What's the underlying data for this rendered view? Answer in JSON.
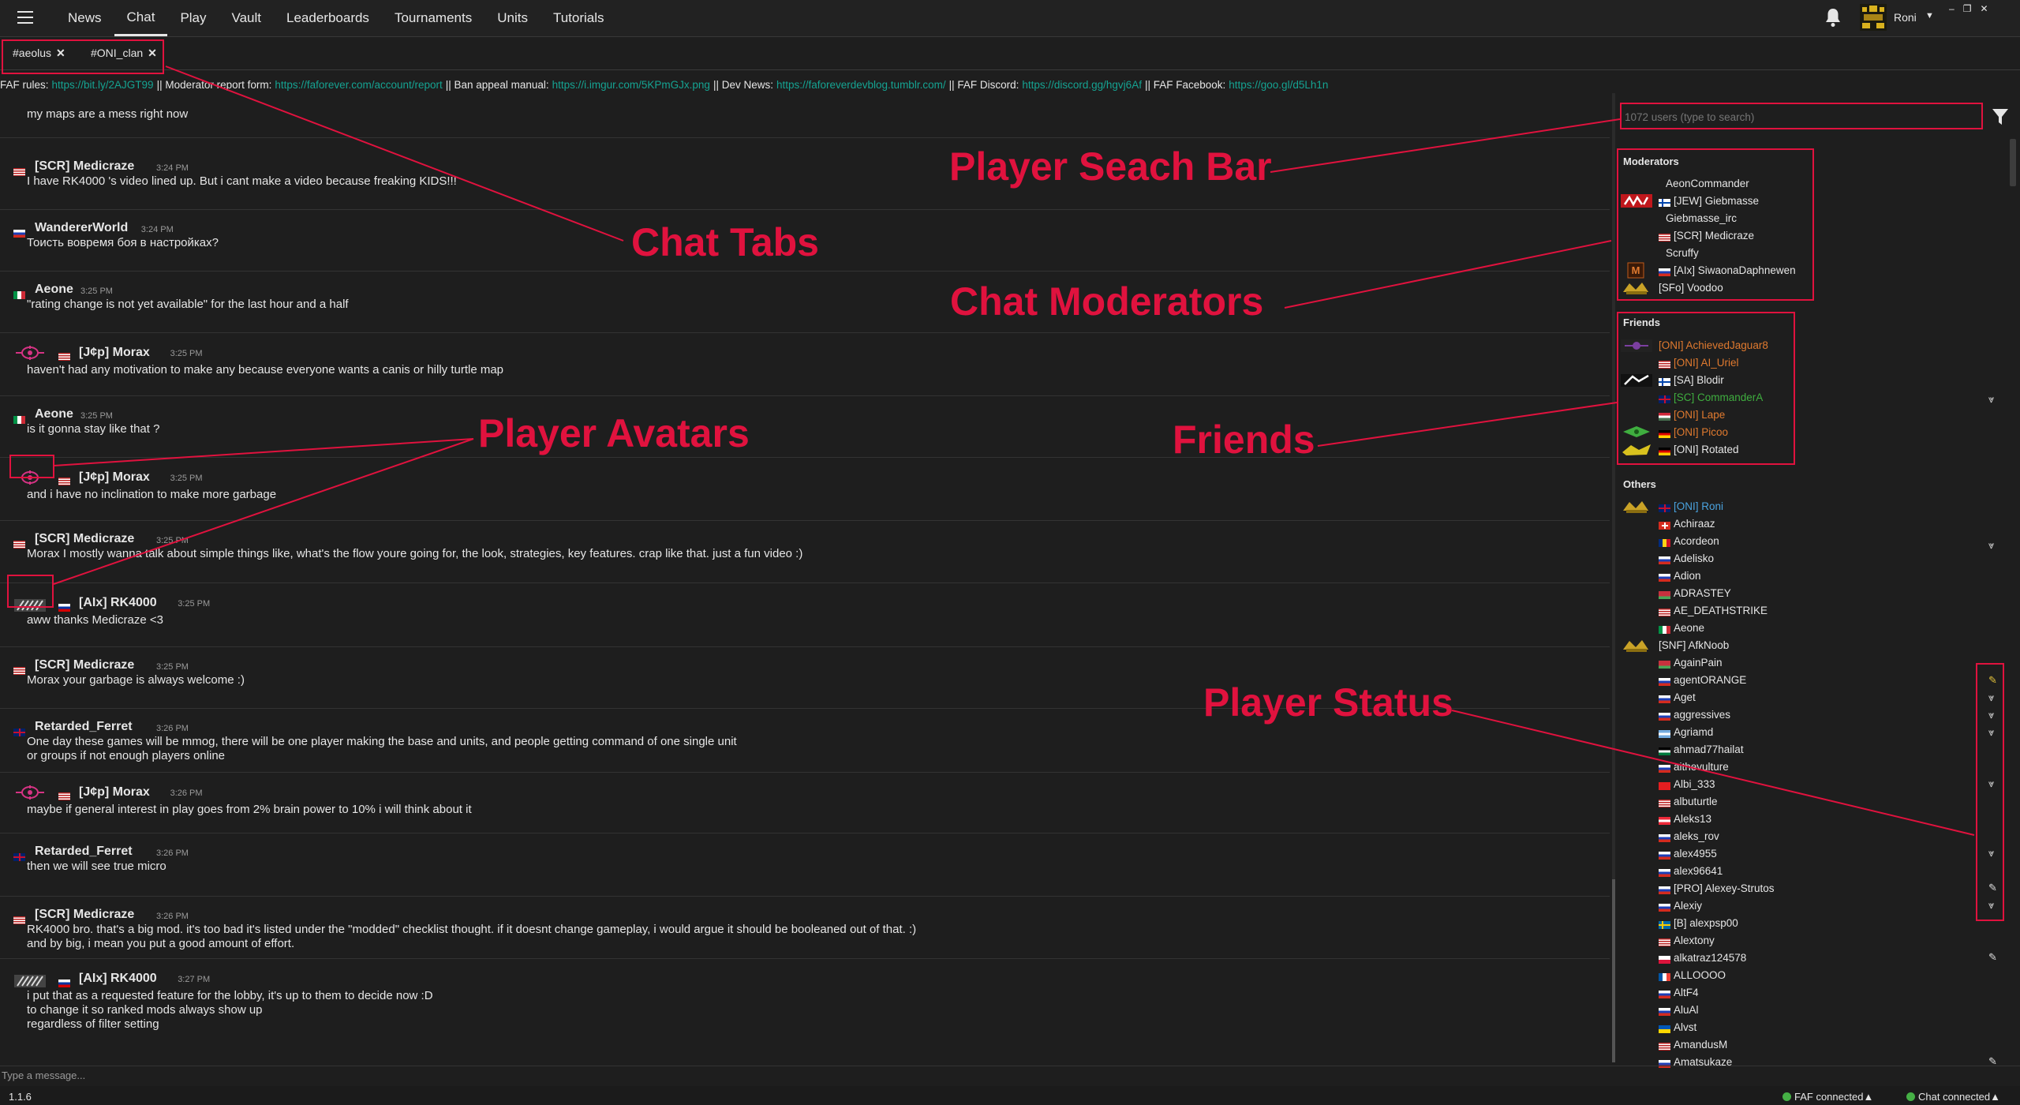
{
  "nav": {
    "items": [
      "News",
      "Chat",
      "Play",
      "Vault",
      "Leaderboards",
      "Tournaments",
      "Units",
      "Tutorials"
    ],
    "active": "Chat",
    "username": "Roni"
  },
  "tabs": [
    "#aeolus",
    "#ONI_clan"
  ],
  "topic": [
    {
      "t": "FAF rules:",
      "link": false
    },
    {
      "t": "https://bit.ly/2AJGT99",
      "link": true
    },
    {
      "t": "|| Moderator report form:",
      "link": false
    },
    {
      "t": "https://faforever.com/account/report",
      "link": true
    },
    {
      "t": "|| Ban appeal manual:",
      "link": false
    },
    {
      "t": "https://i.imgur.com/5KPmGJx.png",
      "link": true
    },
    {
      "t": "|| Dev News:",
      "link": false
    },
    {
      "t": "https://faforeverdevblog.tumblr.com/",
      "link": true
    },
    {
      "t": "|| FAF Discord:",
      "link": false
    },
    {
      "t": "https://discord.gg/hgvj6Af",
      "link": true
    },
    {
      "t": "|| FAF Facebook:",
      "link": false
    },
    {
      "t": "https://goo.gl/d5Lh1n",
      "link": true
    }
  ],
  "messages": [
    {
      "name": "",
      "time": "",
      "text": "my maps are a mess right now",
      "flag": "us",
      "avatar": ""
    },
    {
      "name": "[SCR] Medicraze",
      "time": "3:24 PM",
      "text": "I have RK4000 's video lined up. But i cant make a video because freaking KIDS!!!",
      "flag": "us",
      "avatar": ""
    },
    {
      "name": "WandererWorld",
      "time": "3:24 PM",
      "text": "Тоисть вовремя боя в настройках?",
      "flag": "ru",
      "avatar": ""
    },
    {
      "name": "Aeone",
      "time": "3:25 PM",
      "text": "\"rating change is not yet available\" for the last hour and a half",
      "flag": "it",
      "avatar": ""
    },
    {
      "name": "[J¢p] Morax",
      "time": "3:25 PM",
      "text": "haven't had any motivation to make any because everyone wants a canis or hilly turtle map",
      "flag": "us",
      "avatar": "pink"
    },
    {
      "name": "Aeone",
      "time": "3:25 PM",
      "text": "is it gonna stay like that ?",
      "flag": "it",
      "avatar": ""
    },
    {
      "name": "[J¢p] Morax",
      "time": "3:25 PM",
      "text": "and i have no inclination to make more garbage",
      "flag": "us",
      "avatar": "pink"
    },
    {
      "name": "[SCR] Medicraze",
      "time": "3:25 PM",
      "text": "Morax I mostly wanna talk about simple things like, what's the flow youre going for, the look, strategies, key features. crap like that. just a fun video :)",
      "flag": "us",
      "avatar": ""
    },
    {
      "name": "[AIx] RK4000",
      "time": "3:25 PM",
      "text": "aww thanks Medicraze <3",
      "flag": "si",
      "avatar": "grey"
    },
    {
      "name": "[SCR] Medicraze",
      "time": "3:25 PM",
      "text": "Morax your garbage is always welcome :)",
      "flag": "us",
      "avatar": ""
    },
    {
      "name": "Retarded_Ferret",
      "time": "3:26 PM",
      "text": "One day these games will be mmog, there will be one player making the base and units, and people getting command of one single unit\nor groups if not enough players online",
      "flag": "gb",
      "avatar": ""
    },
    {
      "name": "[J¢p] Morax",
      "time": "3:26 PM",
      "text": "maybe if general interest in play goes from 2% brain power to 10% i will think about it",
      "flag": "us",
      "avatar": "pink"
    },
    {
      "name": "Retarded_Ferret",
      "time": "3:26 PM",
      "text": "then we will see true micro",
      "flag": "gb",
      "avatar": ""
    },
    {
      "name": "[SCR] Medicraze",
      "time": "3:26 PM",
      "text": "RK4000 bro. that's a big mod. it's too bad it's listed under the \"modded\" checklist thought. if it doesnt change gameplay, i would argue it should be booleaned out of that. :)\nand by big, i mean you put a good amount of effort.",
      "flag": "us",
      "avatar": ""
    },
    {
      "name": "[AIx] RK4000",
      "time": "3:27 PM",
      "text": "i put that as a requested feature for the lobby, it's up to them to decide now :D\nto change it so ranked mods always show up\nregardless of filter setting",
      "flag": "si",
      "avatar": "grey"
    }
  ],
  "input_placeholder": "Type a message...",
  "version": "1.1.6",
  "status": {
    "faf": "FAF connected",
    "chat": "Chat connected"
  },
  "userlist": {
    "search_placeholder": "1072 users (type to search)",
    "categories": {
      "moderators": "Moderators",
      "friends": "Friends",
      "others": "Others"
    },
    "moderators": [
      {
        "name": "AeonCommander",
        "flag": "",
        "color": "#e6e6e6",
        "avatar": ""
      },
      {
        "name": "[JEW] Giebmasse",
        "flag": "fi",
        "color": "#e6e6e6",
        "avatar": "red"
      },
      {
        "name": "Giebmasse_irc",
        "flag": "",
        "color": "#e6e6e6",
        "avatar": ""
      },
      {
        "name": "[SCR] Medicraze",
        "flag": "us",
        "color": "#e6e6e6",
        "avatar": ""
      },
      {
        "name": "Scruffy",
        "flag": "",
        "color": "#e6e6e6",
        "avatar": ""
      },
      {
        "name": "[AIx] SiwaonaDaphnewen",
        "flag": "ru",
        "color": "#e6e6e6",
        "avatar": "m"
      },
      {
        "name": "[SFo] Voodoo",
        "flag": "",
        "color": "#e6e6e6",
        "avatar": "gold"
      }
    ],
    "friends": [
      {
        "name": "[ONI] AchievedJaguar8",
        "flag": "",
        "color": "#e07a2f",
        "avatar": "purple"
      },
      {
        "name": "[ONI] AI_Uriel",
        "flag": "us",
        "color": "#e07a2f",
        "avatar": ""
      },
      {
        "name": "[SA] Blodir",
        "flag": "fi",
        "color": "#e6e6e6",
        "avatar": "white"
      },
      {
        "name": "[SC] CommanderA",
        "flag": "gb",
        "color": "#3fae3f",
        "avatar": ""
      },
      {
        "name": "[ONI] Lape",
        "flag": "hu",
        "color": "#e07a2f",
        "avatar": ""
      },
      {
        "name": "[ONI] Picoo",
        "flag": "de",
        "color": "#e07a2f",
        "avatar": "green"
      },
      {
        "name": "[ONI] Rotated",
        "flag": "de",
        "color": "#e6e6e6",
        "avatar": "yellow"
      }
    ],
    "others": [
      {
        "name": "[ONI] Roni",
        "flag": "gb",
        "color": "#4aa3df",
        "avatar": "gold"
      },
      {
        "name": "Achiraaz",
        "flag": "ch",
        "color": "#e6e6e6",
        "avatar": ""
      },
      {
        "name": "Acordeon",
        "flag": "ro",
        "color": "#e6e6e6",
        "avatar": ""
      },
      {
        "name": "Adelisko",
        "flag": "ru",
        "color": "#e6e6e6",
        "avatar": ""
      },
      {
        "name": "Adion",
        "flag": "ru",
        "color": "#e6e6e6",
        "avatar": ""
      },
      {
        "name": "ADRASTEY",
        "flag": "by",
        "color": "#e6e6e6",
        "avatar": ""
      },
      {
        "name": "AE_DEATHSTRIKE",
        "flag": "us",
        "color": "#e6e6e6",
        "avatar": ""
      },
      {
        "name": "Aeone",
        "flag": "it",
        "color": "#e6e6e6",
        "avatar": ""
      },
      {
        "name": "[SNF] AfkNoob",
        "flag": "",
        "color": "#e6e6e6",
        "avatar": "gold"
      },
      {
        "name": "AgainPain",
        "flag": "by",
        "color": "#e6e6e6",
        "avatar": ""
      },
      {
        "name": "agentORANGE",
        "flag": "ru",
        "color": "#e6e6e6",
        "avatar": ""
      },
      {
        "name": "Aget",
        "flag": "ru",
        "color": "#e6e6e6",
        "avatar": ""
      },
      {
        "name": "aggressives",
        "flag": "ru",
        "color": "#e6e6e6",
        "avatar": ""
      },
      {
        "name": "Agriamd",
        "flag": "ar",
        "color": "#e6e6e6",
        "avatar": ""
      },
      {
        "name": "ahmad77hailat",
        "flag": "jo",
        "color": "#e6e6e6",
        "avatar": ""
      },
      {
        "name": "aithevulture",
        "flag": "ru",
        "color": "#e6e6e6",
        "avatar": ""
      },
      {
        "name": "Albi_333",
        "flag": "al",
        "color": "#e6e6e6",
        "avatar": ""
      },
      {
        "name": "albuturtle",
        "flag": "us",
        "color": "#e6e6e6",
        "avatar": ""
      },
      {
        "name": "Aleks13",
        "flag": "at",
        "color": "#e6e6e6",
        "avatar": ""
      },
      {
        "name": "aleks_rov",
        "flag": "ru",
        "color": "#e6e6e6",
        "avatar": ""
      },
      {
        "name": "alex4955",
        "flag": "ru",
        "color": "#e6e6e6",
        "avatar": ""
      },
      {
        "name": "alex96641",
        "flag": "ru",
        "color": "#e6e6e6",
        "avatar": ""
      },
      {
        "name": "[PRO] Alexey-Strutos",
        "flag": "ru",
        "color": "#e6e6e6",
        "avatar": ""
      },
      {
        "name": "Alexiy",
        "flag": "ru",
        "color": "#e6e6e6",
        "avatar": ""
      },
      {
        "name": "[B] alexpsp00",
        "flag": "se",
        "color": "#e6e6e6",
        "avatar": ""
      },
      {
        "name": "Alextony",
        "flag": "us",
        "color": "#e6e6e6",
        "avatar": ""
      },
      {
        "name": "alkatraz124578",
        "flag": "pl",
        "color": "#e6e6e6",
        "avatar": ""
      },
      {
        "name": "ALLOOOO",
        "flag": "fr",
        "color": "#e6e6e6",
        "avatar": ""
      },
      {
        "name": "AltF4",
        "flag": "ru",
        "color": "#e6e6e6",
        "avatar": ""
      },
      {
        "name": "AluAl",
        "flag": "ru",
        "color": "#e6e6e6",
        "avatar": ""
      },
      {
        "name": "Alvst",
        "flag": "ua",
        "color": "#e6e6e6",
        "avatar": ""
      },
      {
        "name": "AmandusM",
        "flag": "us",
        "color": "#e6e6e6",
        "avatar": ""
      },
      {
        "name": "Amatsukaze",
        "flag": "ru",
        "color": "#e6e6e6",
        "avatar": ""
      }
    ]
  },
  "annotations": [
    "Player Seach Bar",
    "Chat Tabs",
    "Chat Moderators",
    "Player Avatars",
    "Friends",
    "Player Status"
  ],
  "colors": {
    "accent": "#e0123e",
    "link": "#15a392",
    "orange": "#e07a2f",
    "green": "#3fae3f",
    "blue": "#4aa3df"
  }
}
